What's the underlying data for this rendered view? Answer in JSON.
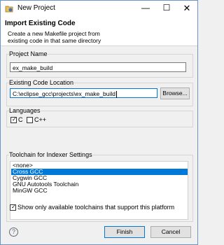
{
  "window": {
    "title": "New Project"
  },
  "controls": {
    "minimize": "—",
    "maximize": "☐",
    "close": "✕"
  },
  "banner": {
    "heading": "Import Existing Code",
    "description": "Create a new Makefile project from existing code in that same directory"
  },
  "project_name": {
    "label": "Project Name",
    "value": "ex_make_build"
  },
  "code_location": {
    "label": "Existing Code Location",
    "value": "C:\\eclipse_gcc\\projects\\ex_make_build",
    "browse_label": "Browse..."
  },
  "languages": {
    "label": "Languages",
    "options": [
      {
        "label": "C",
        "checked": true
      },
      {
        "label": "C++",
        "checked": false
      }
    ]
  },
  "toolchain": {
    "label": "Toolchain for Indexer Settings",
    "items": [
      "<none>",
      "Cross GCC",
      "Cygwin GCC",
      "GNU Autotools Toolchain",
      "MinGW GCC"
    ],
    "selected_index": 1,
    "show_only_label": "Show only available toolchains that support this platform",
    "show_only_checked": true
  },
  "footer": {
    "help": "?",
    "finish_label": "Finish",
    "cancel_label": "Cancel"
  }
}
